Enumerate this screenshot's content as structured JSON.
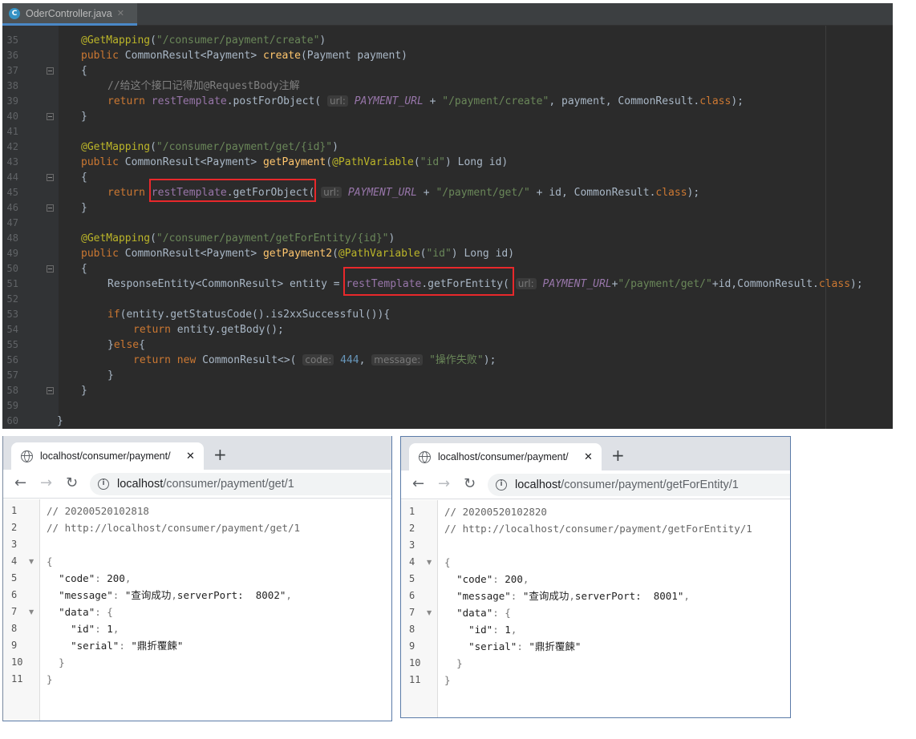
{
  "ide": {
    "tab_title": "OderController.java",
    "tab_icon": "C",
    "lines": [
      {
        "n": "35",
        "fold": false,
        "text": "@GetMapping(\"/consumer/payment/create\")"
      },
      {
        "n": "36",
        "fold": false,
        "text": "public CommonResult<Payment> create(Payment payment)"
      },
      {
        "n": "37",
        "fold": true,
        "text": "{"
      },
      {
        "n": "38",
        "fold": false,
        "text": "//给这个接口记得加@RequestBody注解"
      },
      {
        "n": "39",
        "fold": false,
        "text": "return restTemplate.postForObject( url: PAYMENT_URL + \"/payment/create\", payment, CommonResult.class);"
      },
      {
        "n": "40",
        "fold": true,
        "text": "}"
      },
      {
        "n": "41",
        "fold": false,
        "text": ""
      },
      {
        "n": "42",
        "fold": false,
        "text": "@GetMapping(\"/consumer/payment/get/{id}\")"
      },
      {
        "n": "43",
        "fold": false,
        "text": "public CommonResult<Payment> getPayment(@PathVariable(\"id\") Long id)"
      },
      {
        "n": "44",
        "fold": true,
        "text": "{"
      },
      {
        "n": "45",
        "fold": false,
        "text": "return restTemplate.getForObject( url: PAYMENT_URL + \"/payment/get/\" + id, CommonResult.class);"
      },
      {
        "n": "46",
        "fold": true,
        "text": "}"
      },
      {
        "n": "47",
        "fold": false,
        "text": ""
      },
      {
        "n": "48",
        "fold": false,
        "text": "@GetMapping(\"/consumer/payment/getForEntity/{id}\")"
      },
      {
        "n": "49",
        "fold": false,
        "text": "public CommonResult<Payment> getPayment2(@PathVariable(\"id\") Long id)"
      },
      {
        "n": "50",
        "fold": true,
        "text": "{"
      },
      {
        "n": "51",
        "fold": false,
        "text": "ResponseEntity<CommonResult> entity = restTemplate.getForEntity( url: PAYMENT_URL+\"/payment/get/\"+id,CommonResult.class);"
      },
      {
        "n": "52",
        "fold": false,
        "text": ""
      },
      {
        "n": "53",
        "fold": false,
        "text": "if(entity.getStatusCode().is2xxSuccessful()){"
      },
      {
        "n": "54",
        "fold": false,
        "text": "return entity.getBody();"
      },
      {
        "n": "55",
        "fold": false,
        "text": "}else{"
      },
      {
        "n": "56",
        "fold": false,
        "text": "return new CommonResult<>( code: 444, message: \"操作失败\");"
      },
      {
        "n": "57",
        "fold": false,
        "text": "}"
      },
      {
        "n": "58",
        "fold": true,
        "text": "}"
      },
      {
        "n": "59",
        "fold": false,
        "text": ""
      },
      {
        "n": "60",
        "fold": false,
        "text": "}"
      }
    ],
    "highlight_color": "#e8282b"
  },
  "browsers": [
    {
      "tab_title": "localhost/consumer/payment/",
      "url_host": "localhost",
      "url_path": "/consumer/payment/get/1",
      "lines": [
        {
          "n": "1",
          "text": "// 20200520102818"
        },
        {
          "n": "2",
          "text": "// http://localhost/consumer/payment/get/1"
        },
        {
          "n": "3",
          "text": ""
        },
        {
          "n": "4",
          "text": "{"
        },
        {
          "n": "5",
          "text": "  \"code\": 200,"
        },
        {
          "n": "6",
          "text": "  \"message\": \"查询成功,serverPort:  8002\","
        },
        {
          "n": "7",
          "text": "  \"data\": {"
        },
        {
          "n": "8",
          "text": "    \"id\": 1,"
        },
        {
          "n": "9",
          "text": "    \"serial\": \"鼎折覆餗\""
        },
        {
          "n": "10",
          "text": "  }"
        },
        {
          "n": "11",
          "text": "}"
        }
      ]
    },
    {
      "tab_title": "localhost/consumer/payment/",
      "url_host": "localhost",
      "url_path": "/consumer/payment/getForEntity/1",
      "lines": [
        {
          "n": "1",
          "text": "// 20200520102820"
        },
        {
          "n": "2",
          "text": "// http://localhost/consumer/payment/getForEntity/1"
        },
        {
          "n": "3",
          "text": ""
        },
        {
          "n": "4",
          "text": "{"
        },
        {
          "n": "5",
          "text": "  \"code\": 200,"
        },
        {
          "n": "6",
          "text": "  \"message\": \"查询成功,serverPort:  8001\","
        },
        {
          "n": "7",
          "text": "  \"data\": {"
        },
        {
          "n": "8",
          "text": "    \"id\": 1,"
        },
        {
          "n": "9",
          "text": "    \"serial\": \"鼎折覆餗\""
        },
        {
          "n": "10",
          "text": "  }"
        },
        {
          "n": "11",
          "text": "}"
        }
      ]
    }
  ]
}
